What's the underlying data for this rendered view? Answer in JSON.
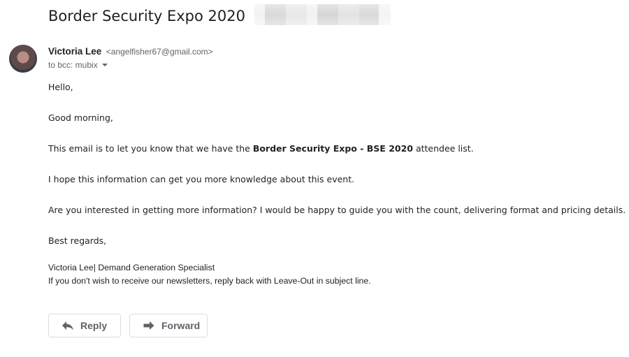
{
  "email": {
    "subject": "Border Security Expo 2020",
    "sender": {
      "name": "Victoria Lee",
      "email": "<angelfisher67@gmail.com>"
    },
    "recipients": "to bcc: mubix",
    "body": {
      "greeting": "Hello,",
      "morning": "Good morning,",
      "line1_prefix": "This email is to let you know that we have the ",
      "line1_bold": "Border Security Expo - BSE 2020",
      "line1_suffix": " attendee list.",
      "line2": "I hope this information can get you more knowledge about this event.",
      "line3": "Are you interested in getting more information? I would be happy to guide you with the count, delivering format and pricing details.",
      "closing": "Best regards,"
    },
    "signature": {
      "line1": "Victoria Lee| Demand Generation Specialist",
      "line2": "If you don't wish to receive our newsletters, reply back with Leave-Out in subject line."
    }
  },
  "actions": {
    "reply_label": "Reply",
    "forward_label": "Forward"
  },
  "icons": {
    "label": "label-outline-icon",
    "caret": "caret-down-icon",
    "reply": "reply-arrow-icon",
    "forward": "forward-arrow-icon"
  },
  "colors": {
    "text": "#222222",
    "muted": "#5f6368",
    "border": "#dadce0"
  }
}
